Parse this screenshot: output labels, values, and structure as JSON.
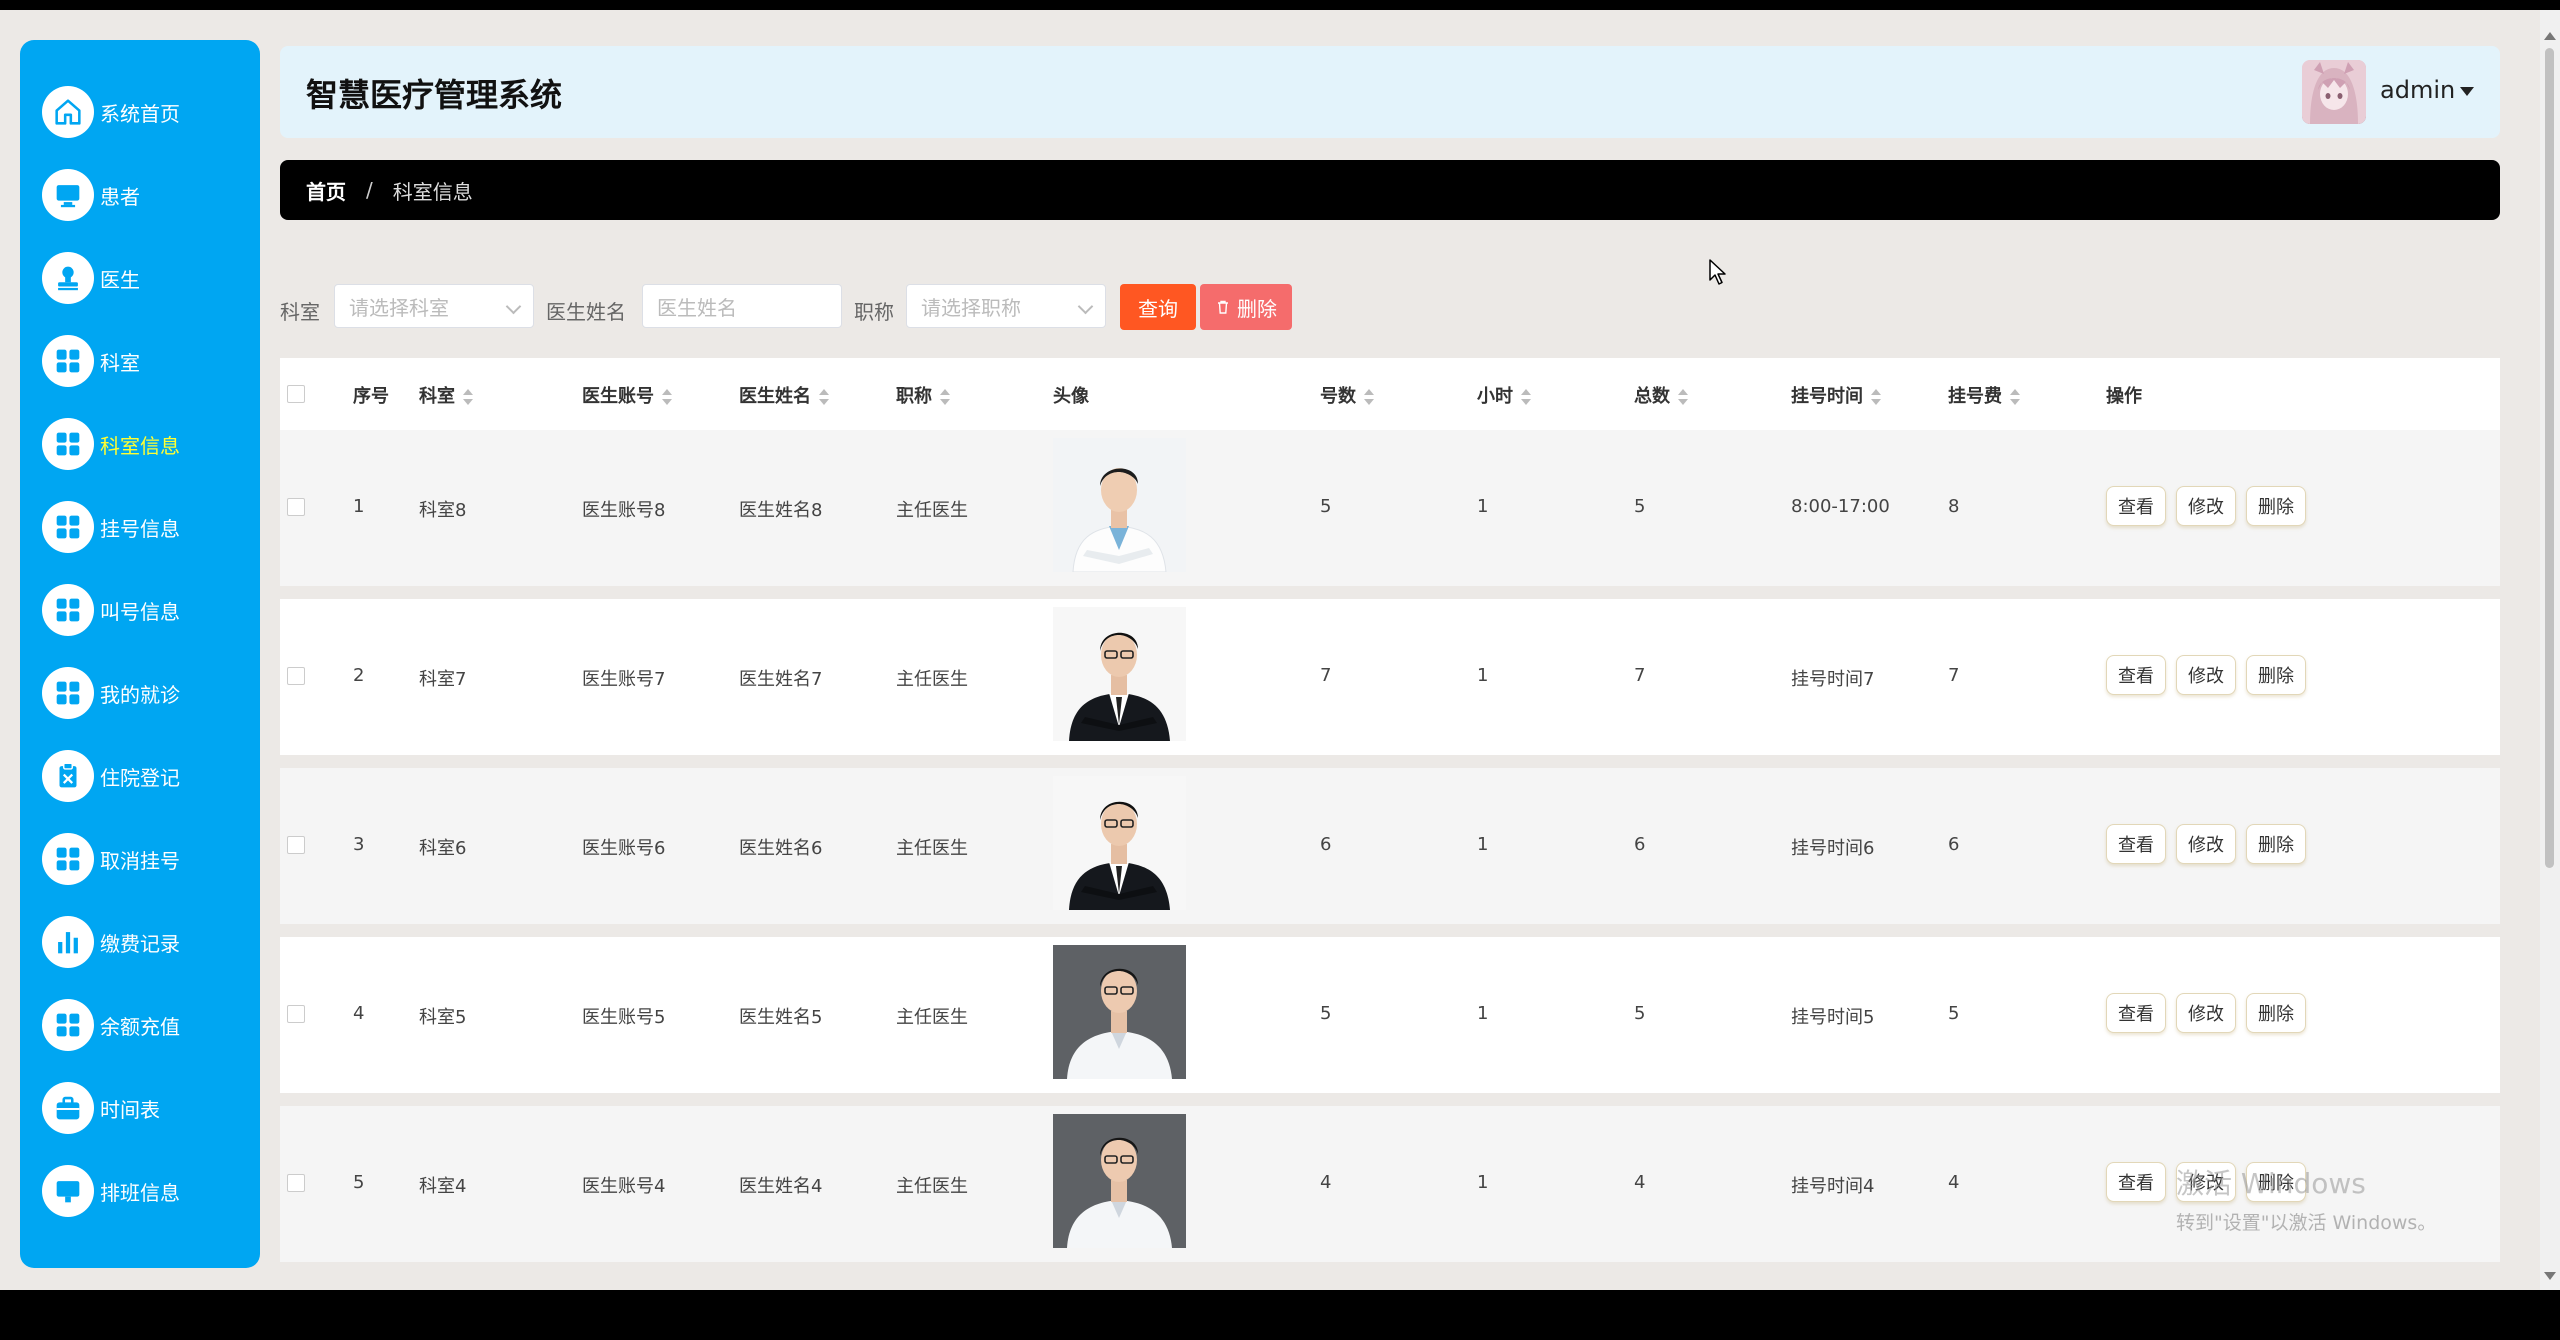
{
  "app": {
    "title": "智慧医疗管理系统",
    "user": "admin"
  },
  "sidebar": {
    "items": [
      {
        "label": "系统首页",
        "icon": "home-icon"
      },
      {
        "label": "患者",
        "icon": "monitor-icon"
      },
      {
        "label": "医生",
        "icon": "stamp-icon"
      },
      {
        "label": "科室",
        "icon": "grid-icon"
      },
      {
        "label": "科室信息",
        "icon": "grid-icon",
        "active": true
      },
      {
        "label": "挂号信息",
        "icon": "grid-icon"
      },
      {
        "label": "叫号信息",
        "icon": "grid-icon"
      },
      {
        "label": "我的就诊",
        "icon": "grid-icon"
      },
      {
        "label": "住院登记",
        "icon": "clipboard-icon"
      },
      {
        "label": "取消挂号",
        "icon": "grid-icon"
      },
      {
        "label": "缴费记录",
        "icon": "bar-chart-icon"
      },
      {
        "label": "余额充值",
        "icon": "grid-icon"
      },
      {
        "label": "时间表",
        "icon": "briefcase-icon"
      },
      {
        "label": "排班信息",
        "icon": "monitor-icon"
      }
    ]
  },
  "breadcrumb": {
    "home": "首页",
    "separator": "/",
    "current": "科室信息"
  },
  "filters": {
    "department_label": "科室",
    "department_placeholder": "请选择科室",
    "doctor_name_label": "医生姓名",
    "doctor_name_placeholder": "医生姓名",
    "title_label": "职称",
    "title_placeholder": "请选择职称",
    "query_button": "查询",
    "delete_button": "删除"
  },
  "table": {
    "headers": {
      "index": "序号",
      "department": "科室",
      "account": "医生账号",
      "name": "医生姓名",
      "title": "职称",
      "avatar": "头像",
      "numbers": "号数",
      "hours": "小时",
      "total": "总数",
      "reg_time": "挂号时间",
      "fee": "挂号费",
      "ops": "操作"
    },
    "actions": {
      "view": "查看",
      "edit": "修改",
      "delete": "删除"
    },
    "rows": [
      {
        "index": "1",
        "department": "科室8",
        "account": "医生账号8",
        "name": "医生姓名8",
        "title": "主任医生",
        "photo": "doctor-white-coat",
        "numbers": "5",
        "hours": "1",
        "total": "5",
        "reg_time": "8:00-17:00",
        "fee": "8"
      },
      {
        "index": "2",
        "department": "科室7",
        "account": "医生账号7",
        "name": "医生姓名7",
        "title": "主任医生",
        "photo": "doctor-suit",
        "numbers": "7",
        "hours": "1",
        "total": "7",
        "reg_time": "挂号时间7",
        "fee": "7"
      },
      {
        "index": "3",
        "department": "科室6",
        "account": "医生账号6",
        "name": "医生姓名6",
        "title": "主任医生",
        "photo": "doctor-suit",
        "numbers": "6",
        "hours": "1",
        "total": "6",
        "reg_time": "挂号时间6",
        "fee": "6"
      },
      {
        "index": "4",
        "department": "科室5",
        "account": "医生账号5",
        "name": "医生姓名5",
        "title": "主任医生",
        "photo": "doctor-grey-bg",
        "numbers": "5",
        "hours": "1",
        "total": "5",
        "reg_time": "挂号时间5",
        "fee": "5"
      },
      {
        "index": "5",
        "department": "科室4",
        "account": "医生账号4",
        "name": "医生姓名4",
        "title": "主任医生",
        "photo": "doctor-grey-bg",
        "numbers": "4",
        "hours": "1",
        "total": "4",
        "reg_time": "挂号时间4",
        "fee": "4"
      }
    ]
  },
  "watermark": {
    "line1": "激活 Windows",
    "line2": "转到\"设置\"以激活 Windows。"
  }
}
